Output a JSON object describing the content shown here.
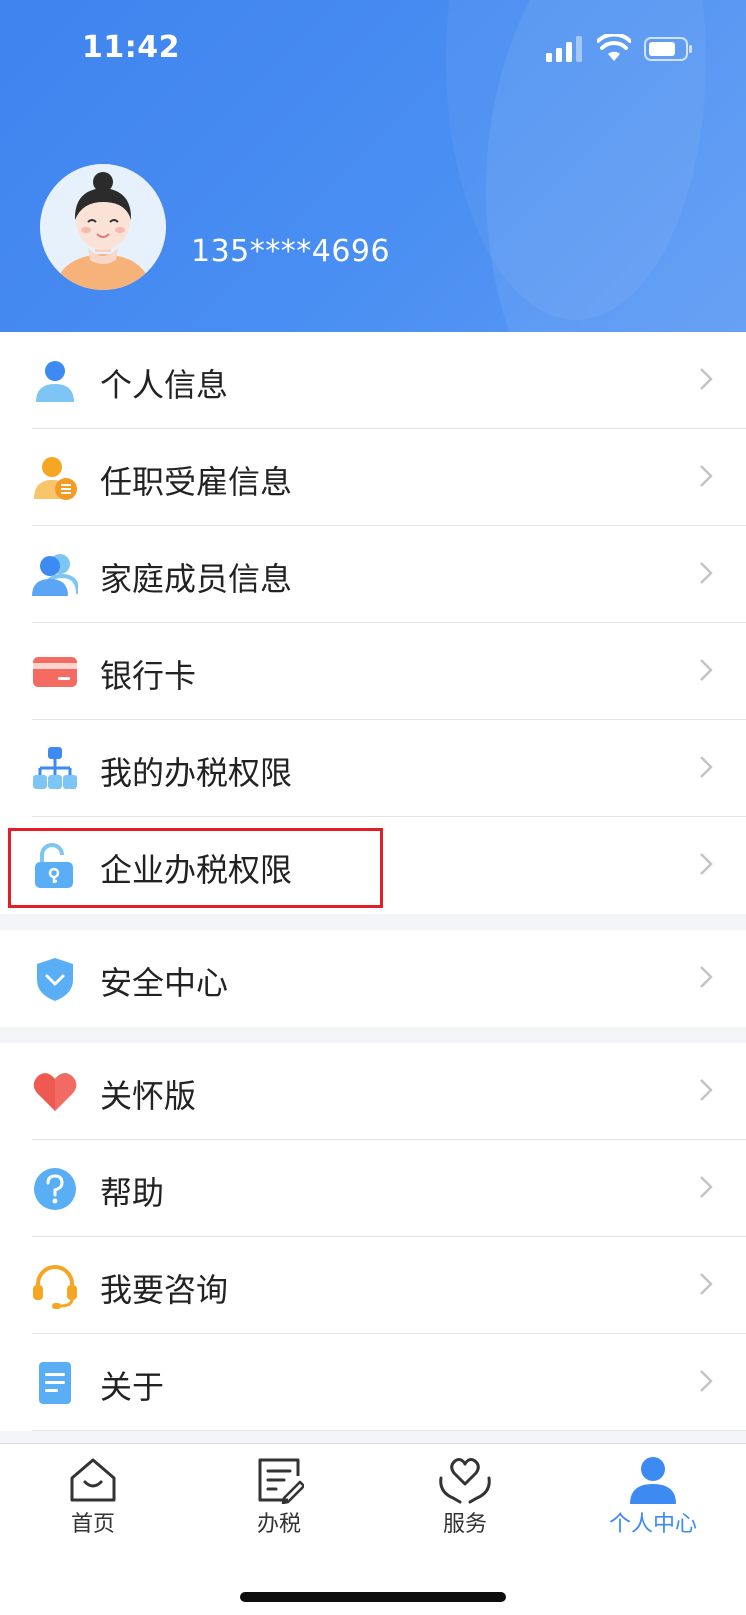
{
  "status_bar": {
    "time": "11:42"
  },
  "profile": {
    "phone": "135****4696"
  },
  "menu_group_1": [
    {
      "label": "个人信息",
      "icon": "person-icon"
    },
    {
      "label": "任职受雇信息",
      "icon": "employment-icon"
    },
    {
      "label": "家庭成员信息",
      "icon": "family-icon"
    },
    {
      "label": "银行卡",
      "icon": "bank-card-icon"
    },
    {
      "label": "我的办税权限",
      "icon": "org-chart-icon"
    },
    {
      "label": "企业办税权限",
      "icon": "unlock-icon"
    }
  ],
  "menu_group_2": [
    {
      "label": "安全中心",
      "icon": "shield-icon"
    }
  ],
  "menu_group_3": [
    {
      "label": "关怀版",
      "icon": "heart-icon"
    },
    {
      "label": "帮助",
      "icon": "help-icon"
    },
    {
      "label": "我要咨询",
      "icon": "headset-icon"
    },
    {
      "label": "关于",
      "icon": "document-icon"
    }
  ],
  "tabs": [
    {
      "label": "首页",
      "icon": "home-icon",
      "active": false
    },
    {
      "label": "办税",
      "icon": "tax-form-icon",
      "active": false
    },
    {
      "label": "服务",
      "icon": "service-heart-icon",
      "active": false
    },
    {
      "label": "个人中心",
      "icon": "user-center-icon",
      "active": true
    }
  ],
  "colors": {
    "header_blue": "#4a8ff2",
    "accent": "#3d8bf2",
    "highlight_red": "#e11f26"
  }
}
